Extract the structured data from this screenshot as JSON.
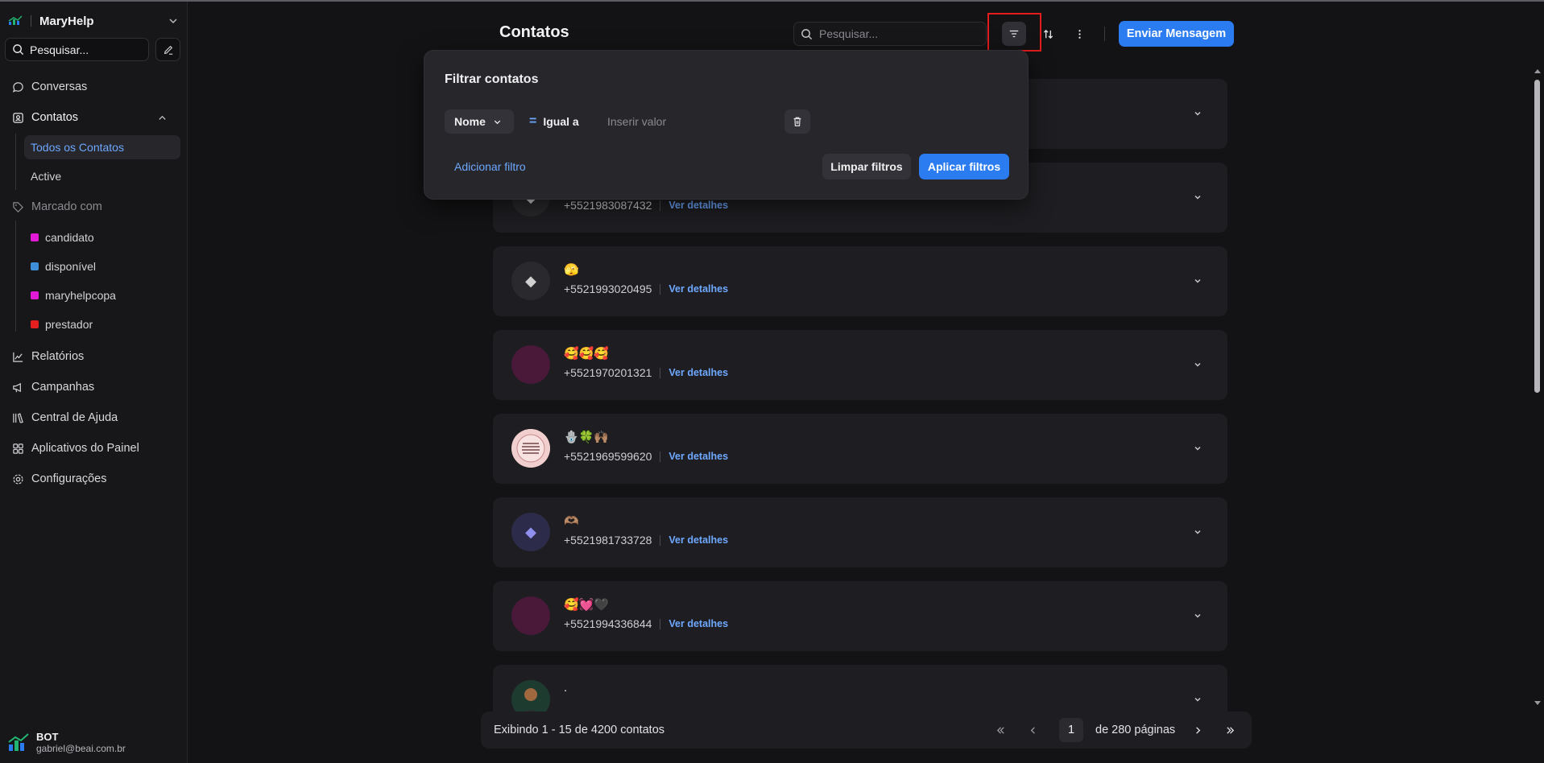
{
  "app": {
    "name": "MaryHelp"
  },
  "sidebar": {
    "search_label": "Pesquisar...",
    "items": {
      "conversas": "Conversas",
      "contatos": "Contatos",
      "todos_contatos": "Todos os Contatos",
      "active": "Active",
      "marcado_com": "Marcado com",
      "relatorios": "Relatórios",
      "campanhas": "Campanhas",
      "central_ajuda": "Central de Ajuda",
      "aplicativos": "Aplicativos do Painel",
      "configuracoes": "Configurações"
    },
    "tags": [
      {
        "label": "candidato",
        "color": "#e21ad8"
      },
      {
        "label": "disponível",
        "color": "#3d8fd9"
      },
      {
        "label": "maryhelpcopa",
        "color": "#e21ad8"
      },
      {
        "label": "prestador",
        "color": "#e51f1f"
      }
    ],
    "user": {
      "name": "BOT",
      "email": "gabriel@beai.com.br"
    }
  },
  "header": {
    "title": "Contatos",
    "search_placeholder": "Pesquisar...",
    "send_button": "Enviar Mensagem"
  },
  "filter": {
    "title": "Filtrar contatos",
    "field": "Nome",
    "operator_symbol": "=",
    "operator": "Igual a",
    "value_placeholder": "Inserir valor",
    "add_filter": "Adicionar filtro",
    "clear": "Limpar filtros",
    "apply": "Aplicar filtros"
  },
  "contacts": {
    "detail_label": "Ver detalhes",
    "items": [
      {
        "name": "",
        "phone": ""
      },
      {
        "name": "",
        "phone": "+5521983087432"
      },
      {
        "name": "🫣",
        "phone": "+5521993020495"
      },
      {
        "name": "🥰🥰🥰",
        "phone": "+5521970201321"
      },
      {
        "name": "🪬🍀🙌🏽",
        "phone": "+5521969599620"
      },
      {
        "name": "🫶🏽",
        "phone": "+5521981733728"
      },
      {
        "name": "🥰💓🖤",
        "phone": "+5521994336844"
      },
      {
        "name": ".",
        "phone": ""
      }
    ]
  },
  "pagination": {
    "info": "Exibindo 1 - 15 de 4200 contatos",
    "current_page": "1",
    "of_pages": "de 280 páginas"
  }
}
